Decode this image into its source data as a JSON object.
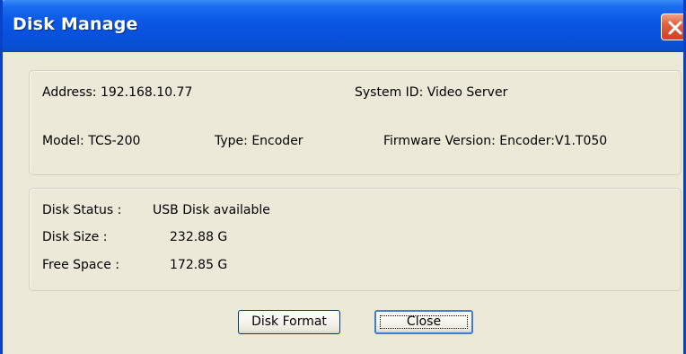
{
  "window": {
    "title": "Disk Manage"
  },
  "device": {
    "address_label": "Address:",
    "address_value": "192.168.10.77",
    "system_id_label": "System ID:",
    "system_id_value": "Video Server",
    "model_label": "Model:",
    "model_value": "TCS-200",
    "type_label": "Type:",
    "type_value": "Encoder",
    "firmware_label": "Firmware Version:",
    "firmware_value": "Encoder:V1.T050"
  },
  "disk": {
    "status_label": "Disk Status :",
    "status_value": "USB Disk available",
    "size_label": "Disk Size :",
    "size_value": "232.88 G",
    "free_label": "Free Space :",
    "free_value": "172.85 G"
  },
  "buttons": {
    "format_label": "Disk Format",
    "close_label": "Close"
  },
  "colors": {
    "titlebar": "#0a58e4",
    "window_bg": "#ece9d8",
    "close_button": "#e06040"
  },
  "icons": {
    "close": "close-icon"
  }
}
